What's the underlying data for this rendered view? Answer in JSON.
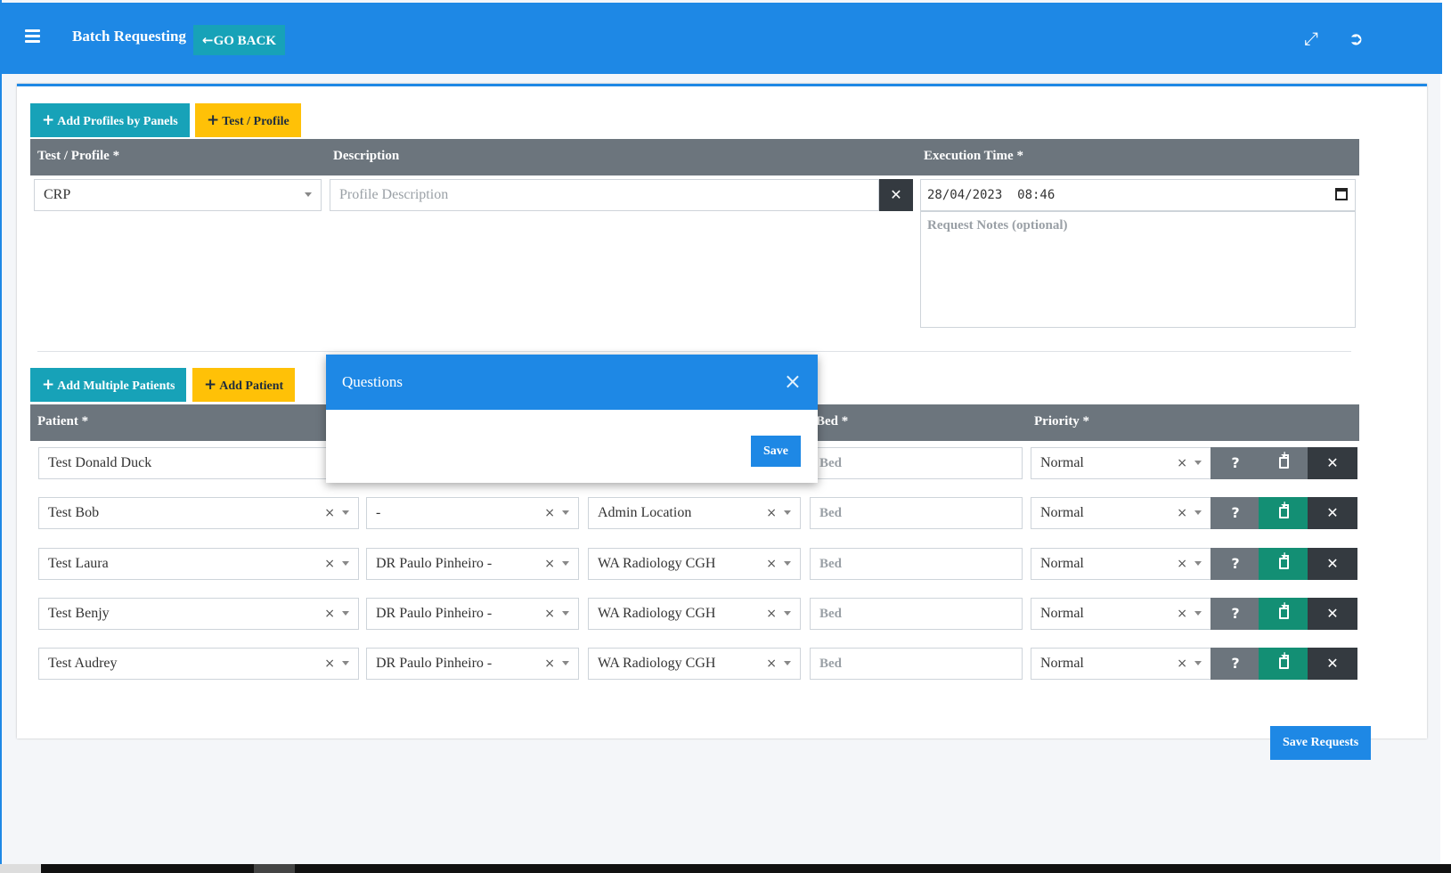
{
  "header": {
    "title": "Batch Requesting",
    "go_back": "GO BACK"
  },
  "profiles": {
    "add_by_panels": "Add Profiles by Panels",
    "add_test_profile": "Test / Profile",
    "headers": [
      "Test / Profile *",
      "Description",
      "Execution Time *"
    ],
    "test_value": "CRP",
    "description_placeholder": "Profile Description",
    "execution_time": "28/04/2023  08:46",
    "notes_placeholder": "Request Notes (optional)"
  },
  "patients": {
    "add_multiple": "Add Multiple Patients",
    "add_patient": "Add Patient",
    "headers": [
      "Patient *",
      "Bed *",
      "Priority *"
    ],
    "bed_placeholder": "Bed",
    "rows": [
      {
        "patient": "Test Donald Duck",
        "doctor": "",
        "location": "",
        "priority": "Normal"
      },
      {
        "patient": "Test Bob",
        "doctor": "-",
        "location": "Admin Location",
        "priority": "Normal"
      },
      {
        "patient": "Test Laura",
        "doctor": "DR Paulo Pinheiro -",
        "location": "WA Radiology CGH",
        "priority": "Normal"
      },
      {
        "patient": "Test Benjy",
        "doctor": "DR Paulo Pinheiro -",
        "location": "WA Radiology CGH",
        "priority": "Normal"
      },
      {
        "patient": "Test Audrey",
        "doctor": "DR Paulo Pinheiro -",
        "location": "WA Radiology CGH",
        "priority": "Normal"
      }
    ]
  },
  "modal": {
    "title": "Questions",
    "save": "Save"
  },
  "footer": {
    "save_requests": "Save Requests"
  },
  "colors": {
    "primary": "#1e88e5",
    "info": "#17a2b8",
    "warning": "#ffc107",
    "header_gray": "#6c757d",
    "success": "#138f74",
    "dark": "#343a40"
  },
  "icons": [
    "menu-icon",
    "arrow-left-icon",
    "plus-icon",
    "expand-icon",
    "sign-out-icon",
    "close-icon",
    "question-icon",
    "clipboard-plus-icon",
    "calendar-icon",
    "clear-icon",
    "chevron-down-icon"
  ]
}
